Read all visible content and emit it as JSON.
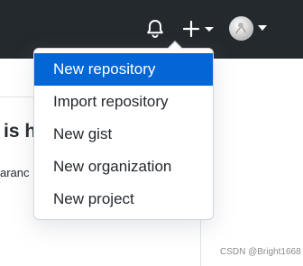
{
  "header": {
    "icons": {
      "notifications": "bell-icon",
      "create": "plus-icon",
      "create_caret": "chevron-down-icon",
      "avatar_caret": "chevron-down-icon"
    }
  },
  "background": {
    "heading": "is h",
    "subtext": "aranc"
  },
  "create_menu": {
    "items": [
      {
        "label": "New repository",
        "active": true
      },
      {
        "label": "Import repository",
        "active": false
      },
      {
        "label": "New gist",
        "active": false
      },
      {
        "label": "New organization",
        "active": false
      },
      {
        "label": "New project",
        "active": false
      }
    ]
  },
  "watermark": "CSDN @Bright1668",
  "colors": {
    "header_bg": "#24292e",
    "active_item_bg": "#0366d6",
    "text": "#24292e"
  }
}
